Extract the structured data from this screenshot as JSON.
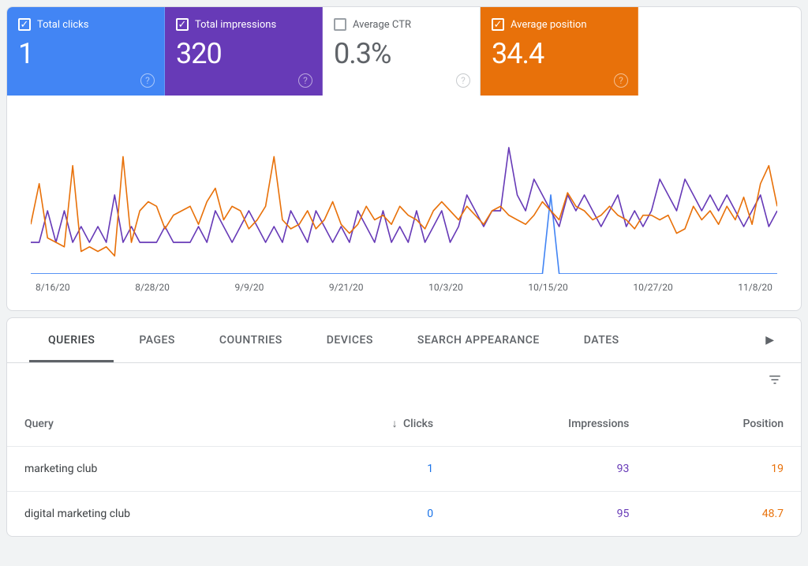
{
  "metrics": {
    "clicks": {
      "label": "Total clicks",
      "value": "1",
      "checked": true,
      "color": "#4285f4"
    },
    "impressions": {
      "label": "Total impressions",
      "value": "320",
      "checked": true,
      "color": "#673ab7"
    },
    "ctr": {
      "label": "Average CTR",
      "value": "0.3%",
      "checked": false,
      "color": "#5f6368"
    },
    "position": {
      "label": "Average position",
      "value": "34.4",
      "checked": true,
      "color": "#e8710a"
    }
  },
  "chart_data": {
    "type": "line",
    "xlabel": "",
    "ylabel": "",
    "categories": [
      "8/16/20",
      "8/28/20",
      "9/9/20",
      "9/21/20",
      "10/3/20",
      "10/15/20",
      "10/27/20",
      "11/8/20"
    ],
    "series": [
      {
        "name": "Total clicks",
        "color": "#4285f4",
        "values": [
          0,
          0,
          0,
          0,
          0,
          0,
          0,
          0,
          0,
          0,
          0,
          0,
          0,
          0,
          0,
          0,
          0,
          0,
          0,
          0,
          0,
          0,
          0,
          0,
          0,
          0,
          0,
          0,
          0,
          0,
          0,
          0,
          0,
          0,
          0,
          0,
          0,
          0,
          0,
          0,
          0,
          0,
          0,
          0,
          0,
          0,
          0,
          0,
          0,
          0,
          0,
          0,
          0,
          0,
          0,
          0,
          0,
          0,
          0,
          0,
          0,
          0,
          1,
          0,
          0,
          0,
          0,
          0,
          0,
          0,
          0,
          0,
          0,
          0,
          0,
          0,
          0,
          0,
          0,
          0,
          0,
          0,
          0,
          0,
          0,
          0,
          0,
          0,
          0,
          0
        ]
      },
      {
        "name": "Total impressions",
        "color": "#673ab7",
        "values": [
          2,
          2,
          4,
          2,
          4,
          2,
          3,
          2,
          3,
          2,
          5,
          2,
          3,
          2,
          2,
          2,
          3,
          2,
          2,
          2,
          3,
          2,
          4,
          3,
          2,
          3,
          4,
          3,
          2,
          3,
          2,
          4,
          3,
          2,
          4,
          3,
          2,
          3,
          2,
          4,
          3,
          2,
          4,
          2,
          3,
          2,
          4,
          2,
          3,
          4,
          2,
          3,
          5,
          4,
          3,
          4,
          4,
          8,
          5,
          4,
          6,
          5,
          4,
          3,
          5,
          4,
          5,
          4,
          3,
          4,
          5,
          3,
          4,
          3,
          4,
          6,
          5,
          4,
          6,
          5,
          4,
          5,
          4,
          5,
          4,
          3,
          4,
          5,
          3,
          4
        ]
      },
      {
        "name": "Average position",
        "color": "#e8710a",
        "values": [
          48,
          30,
          54,
          56,
          58,
          22,
          60,
          58,
          60,
          58,
          62,
          18,
          56,
          42,
          38,
          40,
          50,
          44,
          42,
          40,
          48,
          38,
          32,
          46,
          40,
          42,
          50,
          46,
          40,
          18,
          46,
          50,
          48,
          42,
          50,
          46,
          38,
          48,
          52,
          48,
          40,
          46,
          44,
          48,
          40,
          44,
          46,
          50,
          42,
          38,
          42,
          46,
          40,
          44,
          48,
          42,
          40,
          44,
          46,
          48,
          44,
          38,
          42,
          46,
          34,
          40,
          42,
          46,
          44,
          40,
          44,
          46,
          50,
          44,
          44,
          46,
          44,
          52,
          50,
          40,
          46,
          42,
          48,
          40,
          46,
          36,
          48,
          30,
          22,
          40
        ]
      }
    ],
    "y_max": {
      "clicks": 2,
      "impressions": 10,
      "position": 70
    }
  },
  "tabs": {
    "items": [
      "QUERIES",
      "PAGES",
      "COUNTRIES",
      "DEVICES",
      "SEARCH APPEARANCE",
      "DATES"
    ],
    "active": 0
  },
  "table": {
    "headers": {
      "query": "Query",
      "clicks": "Clicks",
      "impressions": "Impressions",
      "position": "Position"
    },
    "sort": {
      "column": "clicks",
      "dir": "desc"
    },
    "rows": [
      {
        "query": "marketing club",
        "clicks": "1",
        "impressions": "93",
        "position": "19"
      },
      {
        "query": "digital marketing club",
        "clicks": "0",
        "impressions": "95",
        "position": "48.7"
      }
    ]
  }
}
